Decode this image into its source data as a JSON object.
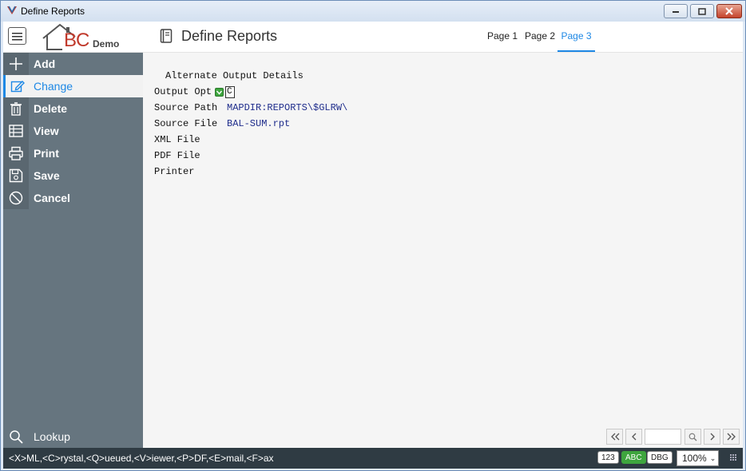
{
  "window": {
    "title": "Define Reports"
  },
  "header": {
    "logo_bc": "BC",
    "logo_demo": "Demo",
    "page_title": "Define Reports",
    "tabs": [
      {
        "label": "Page 1",
        "active": false
      },
      {
        "label": "Page 2",
        "active": false
      },
      {
        "label": "Page 3",
        "active": true
      }
    ]
  },
  "sidebar": {
    "items": [
      {
        "label": "Add",
        "icon": "plus-icon"
      },
      {
        "label": "Change",
        "icon": "edit-icon",
        "active": true
      },
      {
        "label": "Delete",
        "icon": "trash-icon"
      },
      {
        "label": "View",
        "icon": "table-icon"
      },
      {
        "label": "Print",
        "icon": "printer-icon"
      },
      {
        "label": "Save",
        "icon": "save-icon"
      },
      {
        "label": "Cancel",
        "icon": "cancel-icon"
      }
    ],
    "lookup": {
      "label": "Lookup",
      "icon": "search-icon"
    }
  },
  "form": {
    "section_title": "Alternate Output Details",
    "fields": [
      {
        "label": "Output Opt",
        "value": "C"
      },
      {
        "label": "Source Path",
        "value": "MAPDIR:REPORTS\\$GLRW\\"
      },
      {
        "label": "Source File",
        "value": "BAL-SUM.rpt"
      },
      {
        "label": "XML File",
        "value": ""
      },
      {
        "label": "PDF File",
        "value": ""
      },
      {
        "label": "Printer",
        "value": ""
      }
    ]
  },
  "status": {
    "text": "<X>ML,<C>rystal,<Q>ueued,<V>iewer,<P>DF,<E>mail,<F>ax",
    "badge_123": "123",
    "badge_abc": "ABC",
    "badge_dbg": "DBG",
    "zoom": "100%"
  },
  "colors": {
    "accent": "#1e88e5",
    "sidebar": "#66757f",
    "statusbar": "#2f3b43",
    "field_value": "#1f2d8c"
  }
}
